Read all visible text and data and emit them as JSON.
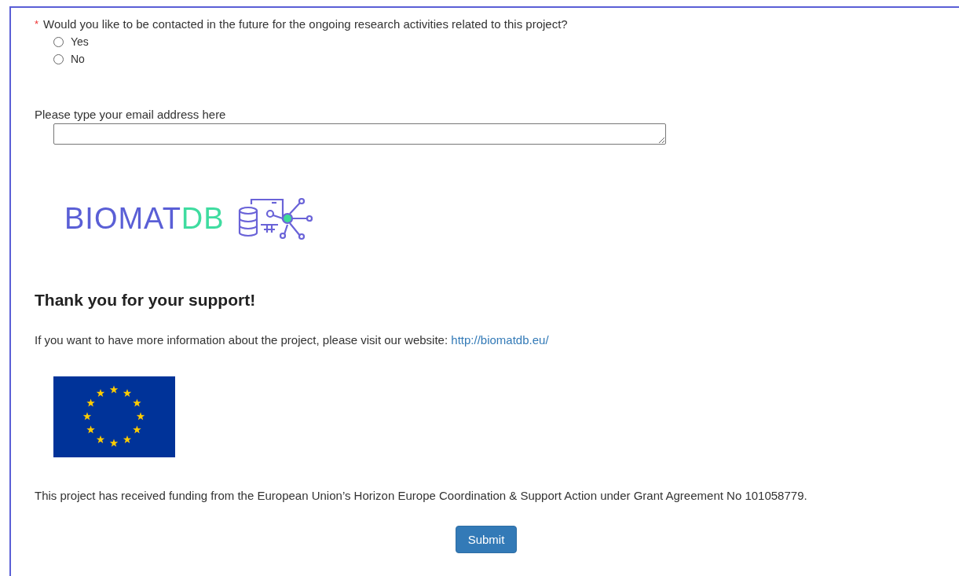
{
  "question": {
    "required_mark": "*",
    "text": "Would you like to be contacted in the future for the ongoing research activities related to this project?",
    "options": [
      {
        "label": "Yes",
        "selected": false
      },
      {
        "label": "No",
        "selected": false
      }
    ]
  },
  "email": {
    "label": "Please type your email address here"
  },
  "logo": {
    "text_1": "BIOMAT",
    "text_2": "DB"
  },
  "thanks": {
    "heading": "Thank you for your support!",
    "info": "If you want to have more information about the project, please visit our website:",
    "link": "http://biomatdb.eu/"
  },
  "funding": "This project has received funding from the European Union’s Horizon Europe Coordination & Support Action under Grant Agreement No 101058779.",
  "submit": "Submit"
}
